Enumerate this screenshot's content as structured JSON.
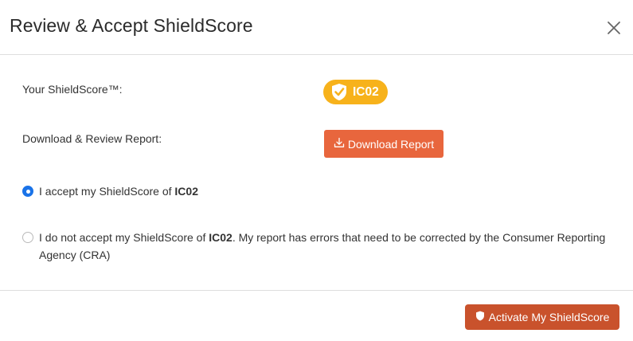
{
  "dialog": {
    "title": "Review & Accept ShieldScore",
    "close_icon": "close-icon"
  },
  "score_row": {
    "label": "Your ShieldScore™:",
    "score": "IC02",
    "badge_color": "#f7b21b",
    "badge_icon": "shield-check-icon"
  },
  "report_row": {
    "label": "Download & Review Report:",
    "button_label": "Download Report",
    "button_icon": "download-icon",
    "button_color": "#e8663d"
  },
  "options": {
    "accept": {
      "text_prefix": "I accept my ShieldScore of ",
      "score": "IC02",
      "selected": true
    },
    "decline": {
      "text_prefix": "I do not accept my ShieldScore of ",
      "score": "IC02",
      "text_suffix": ". My report has errors that need to be corrected by the Consumer Reporting Agency (CRA)",
      "selected": false
    }
  },
  "footer": {
    "activate_label": "Activate My ShieldScore",
    "activate_icon": "shield-icon",
    "activate_color": "#c9522c"
  }
}
